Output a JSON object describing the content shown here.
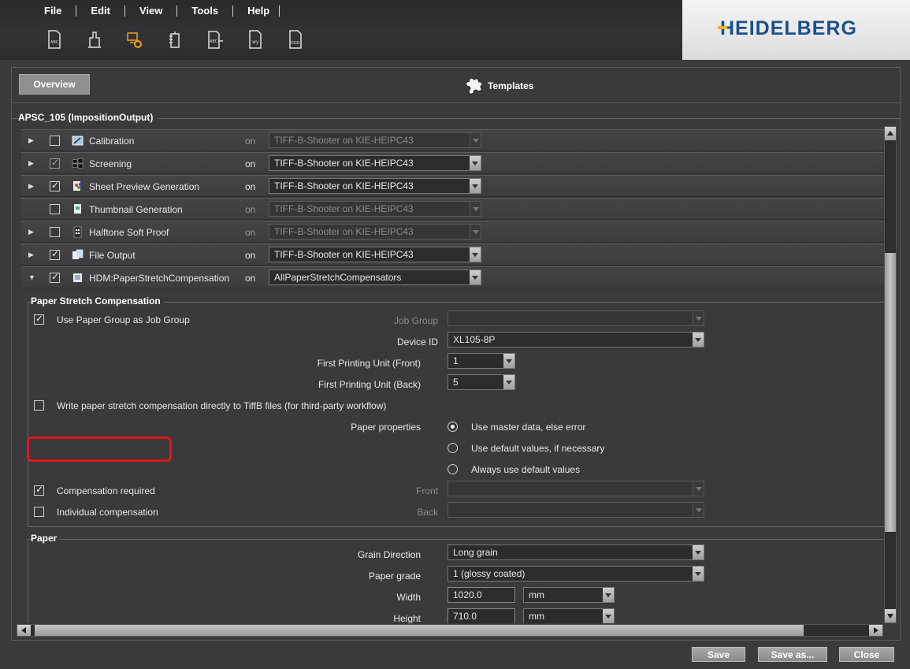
{
  "menu": [
    "File",
    "Edit",
    "View",
    "Tools",
    "Help"
  ],
  "toolbar_icons": [
    "document-abc-icon",
    "building-icon",
    "computer-gear-icon",
    "tree-doc-icon",
    "abc-arrow-icon",
    "wy-doc-icon",
    "ddd-doc-icon"
  ],
  "logo": "HEIDELBERG",
  "overview_label": "Overview",
  "templates_label": "Templates",
  "group_title": "APSC_105 (ImpositionOutput)",
  "rows": [
    {
      "label": "Calibration",
      "checked": false,
      "on": "on",
      "value": "TIFF-B-Shooter on KIE-HEIPC43",
      "enabled": false
    },
    {
      "label": "Screening",
      "checked": true,
      "on": "on",
      "value": "TIFF-B-Shooter on KIE-HEIPC43",
      "enabled": true
    },
    {
      "label": "Sheet Preview Generation",
      "checked": true,
      "on": "on",
      "value": "TIFF-B-Shooter on KIE-HEIPC43",
      "enabled": true
    },
    {
      "label": "Thumbnail Generation",
      "checked": false,
      "on": "on",
      "value": "TIFF-B-Shooter on KIE-HEIPC43",
      "enabled": false
    },
    {
      "label": "Halftone Soft Proof",
      "checked": false,
      "on": "on",
      "value": "TIFF-B-Shooter on KIE-HEIPC43",
      "enabled": false
    },
    {
      "label": "File Output",
      "checked": true,
      "on": "on",
      "value": "TIFF-B-Shooter on KIE-HEIPC43",
      "enabled": true
    },
    {
      "label": "HDM:PaperStretchCompensation",
      "checked": true,
      "on": "on",
      "value": "AllPaperStretchCompensators",
      "enabled": true
    }
  ],
  "psc": {
    "title": "Paper Stretch Compensation",
    "use_paper_group": "Use Paper Group as Job Group",
    "job_group_label": "Job Group",
    "job_group_value": "",
    "device_id_label": "Device ID",
    "device_id_value": "XL105-8P",
    "first_front_label": "First Printing Unit (Front)",
    "first_front_value": "1",
    "first_back_label": "First Printing Unit (Back)",
    "first_back_value": "5",
    "write_tiffb": "Write paper stretch compensation directly to TiffB files (for third-party workflow)",
    "paper_props_label": "Paper properties",
    "radio1": "Use master data, else error",
    "radio2": "Use default values, if necessary",
    "radio3": "Always use default values",
    "comp_required": "Compensation required",
    "front_label": "Front",
    "individual": "Individual compensation",
    "back_label": "Back"
  },
  "paper": {
    "title": "Paper",
    "grain_label": "Grain Direction",
    "grain_value": "Long grain",
    "grade_label": "Paper grade",
    "grade_value": "1 (glossy coated)",
    "width_label": "Width",
    "width_value": "1020.0",
    "width_unit": "mm",
    "height_label": "Height",
    "height_value": "710.0",
    "height_unit": "mm"
  },
  "buttons": {
    "save": "Save",
    "save_as": "Save as...",
    "close": "Close"
  }
}
